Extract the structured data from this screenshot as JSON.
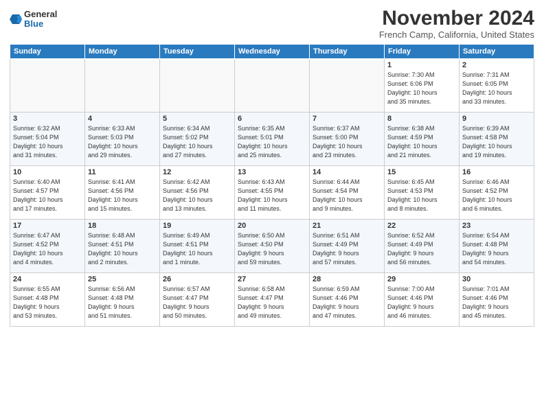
{
  "header": {
    "logo_general": "General",
    "logo_blue": "Blue",
    "month_title": "November 2024",
    "location": "French Camp, California, United States"
  },
  "days_of_week": [
    "Sunday",
    "Monday",
    "Tuesday",
    "Wednesday",
    "Thursday",
    "Friday",
    "Saturday"
  ],
  "weeks": [
    [
      {
        "day": "",
        "info": ""
      },
      {
        "day": "",
        "info": ""
      },
      {
        "day": "",
        "info": ""
      },
      {
        "day": "",
        "info": ""
      },
      {
        "day": "",
        "info": ""
      },
      {
        "day": "1",
        "info": "Sunrise: 7:30 AM\nSunset: 6:06 PM\nDaylight: 10 hours\nand 35 minutes."
      },
      {
        "day": "2",
        "info": "Sunrise: 7:31 AM\nSunset: 6:05 PM\nDaylight: 10 hours\nand 33 minutes."
      }
    ],
    [
      {
        "day": "3",
        "info": "Sunrise: 6:32 AM\nSunset: 5:04 PM\nDaylight: 10 hours\nand 31 minutes."
      },
      {
        "day": "4",
        "info": "Sunrise: 6:33 AM\nSunset: 5:03 PM\nDaylight: 10 hours\nand 29 minutes."
      },
      {
        "day": "5",
        "info": "Sunrise: 6:34 AM\nSunset: 5:02 PM\nDaylight: 10 hours\nand 27 minutes."
      },
      {
        "day": "6",
        "info": "Sunrise: 6:35 AM\nSunset: 5:01 PM\nDaylight: 10 hours\nand 25 minutes."
      },
      {
        "day": "7",
        "info": "Sunrise: 6:37 AM\nSunset: 5:00 PM\nDaylight: 10 hours\nand 23 minutes."
      },
      {
        "day": "8",
        "info": "Sunrise: 6:38 AM\nSunset: 4:59 PM\nDaylight: 10 hours\nand 21 minutes."
      },
      {
        "day": "9",
        "info": "Sunrise: 6:39 AM\nSunset: 4:58 PM\nDaylight: 10 hours\nand 19 minutes."
      }
    ],
    [
      {
        "day": "10",
        "info": "Sunrise: 6:40 AM\nSunset: 4:57 PM\nDaylight: 10 hours\nand 17 minutes."
      },
      {
        "day": "11",
        "info": "Sunrise: 6:41 AM\nSunset: 4:56 PM\nDaylight: 10 hours\nand 15 minutes."
      },
      {
        "day": "12",
        "info": "Sunrise: 6:42 AM\nSunset: 4:56 PM\nDaylight: 10 hours\nand 13 minutes."
      },
      {
        "day": "13",
        "info": "Sunrise: 6:43 AM\nSunset: 4:55 PM\nDaylight: 10 hours\nand 11 minutes."
      },
      {
        "day": "14",
        "info": "Sunrise: 6:44 AM\nSunset: 4:54 PM\nDaylight: 10 hours\nand 9 minutes."
      },
      {
        "day": "15",
        "info": "Sunrise: 6:45 AM\nSunset: 4:53 PM\nDaylight: 10 hours\nand 8 minutes."
      },
      {
        "day": "16",
        "info": "Sunrise: 6:46 AM\nSunset: 4:52 PM\nDaylight: 10 hours\nand 6 minutes."
      }
    ],
    [
      {
        "day": "17",
        "info": "Sunrise: 6:47 AM\nSunset: 4:52 PM\nDaylight: 10 hours\nand 4 minutes."
      },
      {
        "day": "18",
        "info": "Sunrise: 6:48 AM\nSunset: 4:51 PM\nDaylight: 10 hours\nand 2 minutes."
      },
      {
        "day": "19",
        "info": "Sunrise: 6:49 AM\nSunset: 4:51 PM\nDaylight: 10 hours\nand 1 minute."
      },
      {
        "day": "20",
        "info": "Sunrise: 6:50 AM\nSunset: 4:50 PM\nDaylight: 9 hours\nand 59 minutes."
      },
      {
        "day": "21",
        "info": "Sunrise: 6:51 AM\nSunset: 4:49 PM\nDaylight: 9 hours\nand 57 minutes."
      },
      {
        "day": "22",
        "info": "Sunrise: 6:52 AM\nSunset: 4:49 PM\nDaylight: 9 hours\nand 56 minutes."
      },
      {
        "day": "23",
        "info": "Sunrise: 6:54 AM\nSunset: 4:48 PM\nDaylight: 9 hours\nand 54 minutes."
      }
    ],
    [
      {
        "day": "24",
        "info": "Sunrise: 6:55 AM\nSunset: 4:48 PM\nDaylight: 9 hours\nand 53 minutes."
      },
      {
        "day": "25",
        "info": "Sunrise: 6:56 AM\nSunset: 4:48 PM\nDaylight: 9 hours\nand 51 minutes."
      },
      {
        "day": "26",
        "info": "Sunrise: 6:57 AM\nSunset: 4:47 PM\nDaylight: 9 hours\nand 50 minutes."
      },
      {
        "day": "27",
        "info": "Sunrise: 6:58 AM\nSunset: 4:47 PM\nDaylight: 9 hours\nand 49 minutes."
      },
      {
        "day": "28",
        "info": "Sunrise: 6:59 AM\nSunset: 4:46 PM\nDaylight: 9 hours\nand 47 minutes."
      },
      {
        "day": "29",
        "info": "Sunrise: 7:00 AM\nSunset: 4:46 PM\nDaylight: 9 hours\nand 46 minutes."
      },
      {
        "day": "30",
        "info": "Sunrise: 7:01 AM\nSunset: 4:46 PM\nDaylight: 9 hours\nand 45 minutes."
      }
    ]
  ]
}
